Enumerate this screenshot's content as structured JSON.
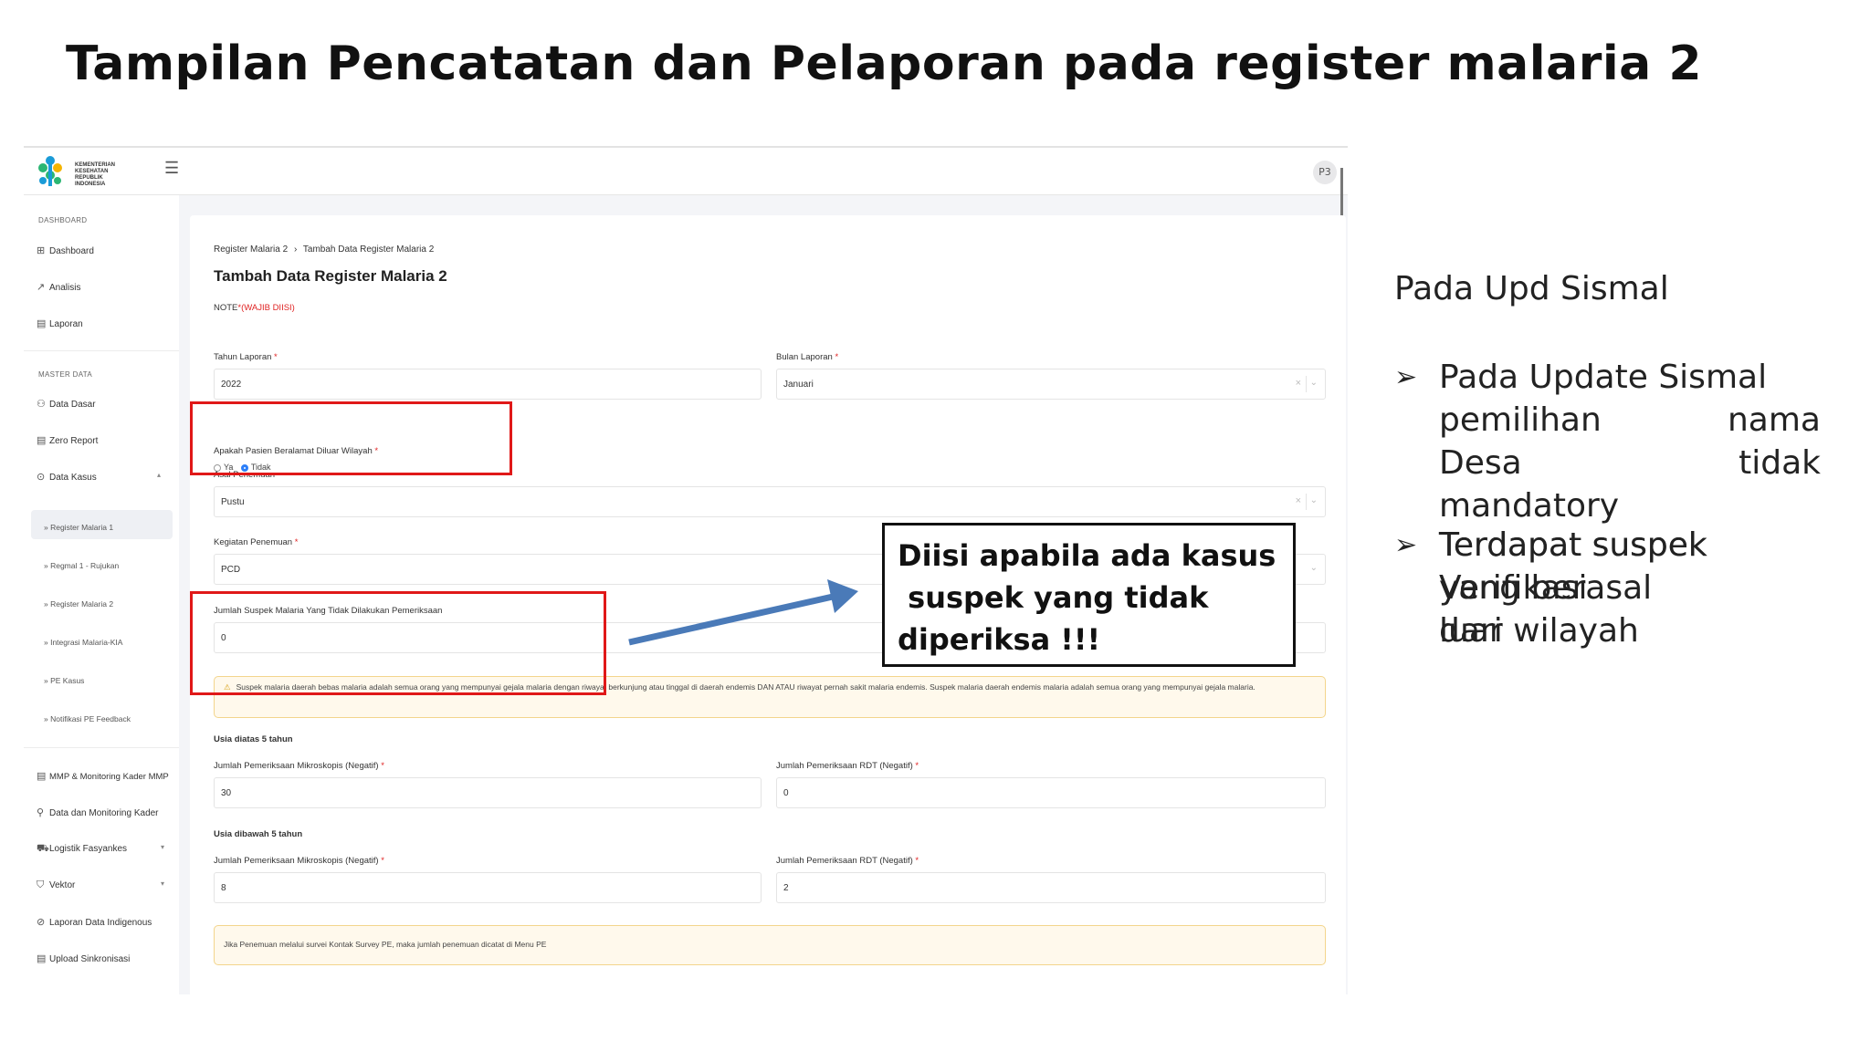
{
  "slide": {
    "title": "Tampilan Pencatatan dan Pelaporan pada register malaria 2"
  },
  "app": {
    "logo_text": "KEMENTERIAN KESEHATAN REPUBLIK INDONESIA",
    "menu_icon": "hamburger-icon",
    "avatar": "P3"
  },
  "sidebar": {
    "dashboard_header": "DASHBOARD",
    "items_top": [
      {
        "label": "Dashboard",
        "icon": "grid-icon"
      },
      {
        "label": "Analisis",
        "icon": "trend-icon"
      },
      {
        "label": "Laporan",
        "icon": "document-icon"
      }
    ],
    "master_header": "MASTER DATA",
    "items_master": [
      {
        "label": "Data Dasar",
        "icon": "users-icon"
      },
      {
        "label": "Zero Report",
        "icon": "document-icon"
      },
      {
        "label": "Data Kasus",
        "icon": "circle-icon"
      }
    ],
    "sub_items": [
      "Register Malaria 1",
      "Regmal 1 - Rujukan",
      "Register Malaria 2",
      "Integrasi Malaria-KIA",
      "PE Kasus",
      "Notifikasi PE Feedback"
    ],
    "items_bottom": [
      {
        "label": "MMP & Monitoring Kader MMP",
        "icon": "document-icon"
      },
      {
        "label": "Data dan Monitoring Kader",
        "icon": "user-icon"
      },
      {
        "label": "Logistik Fasyankes",
        "icon": "truck-icon"
      },
      {
        "label": "Vektor",
        "icon": "shield-icon"
      },
      {
        "label": "Laporan Data Indigenous",
        "icon": "check-circle-icon"
      },
      {
        "label": "Upload Sinkronisasi",
        "icon": "document-icon"
      }
    ]
  },
  "form": {
    "breadcrumb_1": "Register Malaria 2",
    "breadcrumb_sep": "›",
    "breadcrumb_2": "Tambah Data Register Malaria 2",
    "title": "Tambah Data Register Malaria 2",
    "note_prefix": "NOTE",
    "note_required": "*(WAJIB DIISI)",
    "tahun_label": "Tahun Laporan",
    "tahun_value": "2022",
    "bulan_label": "Bulan Laporan",
    "bulan_value": "Januari",
    "diluar_label": "Apakah Pasien Beralamat Diluar Wilayah",
    "radio_ya": "Ya",
    "radio_tidak": "Tidak",
    "asal_label": "Asal Penemuan",
    "asal_value": "Pustu",
    "kegiatan_label": "Kegiatan Penemuan",
    "kegiatan_value": "PCD",
    "suspek_label": "Jumlah Suspek Malaria Yang Tidak Dilakukan Pemeriksaan",
    "suspek_value": "0",
    "alert_suspek": "Suspek malaria daerah bebas malaria adalah semua orang yang mempunyai gejala malaria dengan riwayat berkunjung atau tinggal di daerah endemis DAN ATAU riwayat pernah sakit malaria endemis. Suspek malaria daerah endemis malaria adalah semua orang yang mempunyai gejala malaria.",
    "usia_atas": "Usia diatas 5 tahun",
    "mikro_label": "Jumlah Pemeriksaan Mikroskopis (Negatif)",
    "rdt_label": "Jumlah Pemeriksaan RDT (Negatif)",
    "atas_mikro_value": "30",
    "atas_rdt_value": "0",
    "usia_bawah": "Usia dibawah 5 tahun",
    "bawah_mikro_value": "8",
    "bawah_rdt_value": "2",
    "alert_pe": "Jika Penemuan melalui survei Kontak Survey PE, maka jumlah penemuan dicatat di Menu PE",
    "required_mark": "*",
    "clear_mark": "×",
    "caret_mark": "⌄"
  },
  "callout": {
    "line1": "Diisi apabila ada kasus",
    "line2": " suspek yang tidak",
    "line3": "diperiksa !!!"
  },
  "notes": {
    "heading": "Pada Upd Sismal",
    "bullet_marker": "➢",
    "bullet1_line1": "Pada Update Sismal",
    "bullet1_line2_a": "pemilihan",
    "bullet1_line2_b": "nama",
    "bullet1_line3_a": "Desa",
    "bullet1_line3_b": "tidak",
    "bullet1_line4": "mandatory",
    "bullet2_back_1": "Terdapat suspek",
    "bullet2_back_2": "yang berasal",
    "bullet2_back_3": "dari wilayah",
    "bullet2_front_1": "Terdapat suspek",
    "bullet2_front_2": "Verifikasi",
    "bullet2_front_3": "luar"
  },
  "colors": {
    "highlight_red": "#e01818",
    "arrow_blue": "#4a7ab8",
    "radio_blue": "#2d7ff9",
    "alert_border": "#f3d58c"
  }
}
